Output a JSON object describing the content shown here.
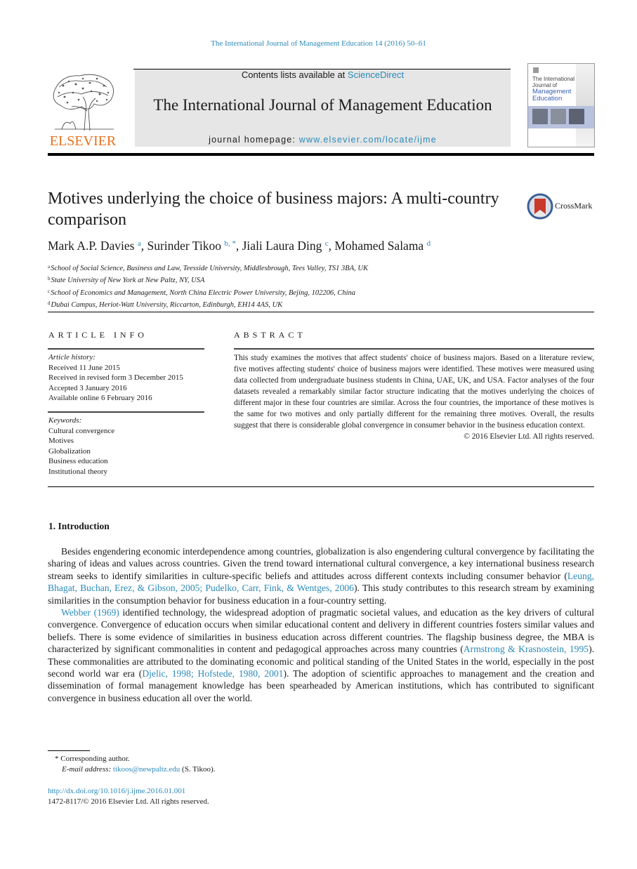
{
  "running_header": {
    "citation": "The International Journal of Management Education 14 (2016) 50–61"
  },
  "masthead": {
    "publisher_wordmark": "ELSEVIER",
    "contents_prefix": "Contents lists available at ",
    "contents_link": "ScienceDirect",
    "journal_title": "The International Journal of Management Education",
    "homepage_prefix": "journal homepage: ",
    "homepage_link": "www.elsevier.com/locate/ijme",
    "cover": {
      "line1": "The International",
      "line2": "Journal of",
      "line3": "Management",
      "line4": "Education"
    },
    "colors": {
      "link": "#2a89b9",
      "elsevier_orange": "#e9711c",
      "masthead_gray": "#e6e6e6"
    }
  },
  "article": {
    "title": "Motives underlying the choice of business majors: A multi-country comparison",
    "crossmark_label": "CrossMark",
    "authors": [
      {
        "name": "Mark A.P. Davies",
        "sup": "a"
      },
      {
        "name": "Surinder Tikoo",
        "sup": "b, *"
      },
      {
        "name": "Jiali Laura Ding",
        "sup": "c"
      },
      {
        "name": "Mohamed Salama",
        "sup": "d"
      }
    ],
    "affiliations": [
      {
        "key": "a",
        "text": "School of Social Science, Business and Law, Teesside University, Middlesbrough, Tees Valley, TS1 3BA, UK"
      },
      {
        "key": "b",
        "text": "State University of New York at New Paltz, NY, USA"
      },
      {
        "key": "c",
        "text": "School of Economics and Management, North China Electric Power University, Bejing, 102206, China"
      },
      {
        "key": "d",
        "text": "Dubai Campus, Heriot-Watt University, Riccarton, Edinburgh, EH14 4AS, UK"
      }
    ]
  },
  "article_info": {
    "heading": "ARTICLE INFO",
    "history_label": "Article history:",
    "history": [
      "Received 11 June 2015",
      "Received in revised form 3 December 2015",
      "Accepted 3 January 2016",
      "Available online 6 February 2016"
    ],
    "keywords_label": "Keywords:",
    "keywords": [
      "Cultural convergence",
      "Motives",
      "Globalization",
      "Business education",
      "Institutional theory"
    ]
  },
  "abstract": {
    "heading": "ABSTRACT",
    "text": "This study examines the motives that affect students' choice of business majors. Based on a literature review, five motives affecting students' choice of business majors were identified. These motives were measured using data collected from undergraduate business students in China, UAE, UK, and USA. Factor analyses of the four datasets revealed a remarkably similar factor structure indicating that the motives underlying the choices of different major in these four countries are similar. Across the four countries, the importance of these motives is the same for two motives and only partially different for the remaining three motives. Overall, the results suggest that there is considerable global convergence in consumer behavior in the business education context.",
    "copyright": "© 2016 Elsevier Ltd. All rights reserved."
  },
  "introduction": {
    "heading": "1.  Introduction",
    "p1": {
      "t1": "Besides engendering economic interdependence among countries, globalization is also engendering cultural convergence by facilitating the sharing of ideas and values across countries. Given the trend toward international cultural convergence, a key international business research stream seeks to identify similarities in culture-specific beliefs and attitudes across different contexts including consumer behavior (",
      "ref1": "Leung, Bhagat, Buchan, Erez, & Gibson, 2005; Pudelko, Carr, Fink, & Wentges, 2006",
      "t2": "). This study contributes to this research stream by examining similarities in the consumption behavior for business education in a four-country setting."
    },
    "p2": {
      "ref1": "Webber (1969)",
      "t1": " identified technology, the widespread adoption of pragmatic societal values, and education as the key drivers of cultural convergence. Convergence of education occurs when similar educational content and delivery in different countries fosters similar values and beliefs. There is some evidence of similarities in business education across different countries. The flagship business degree, the MBA is characterized by significant commonalities in content and pedagogical approaches across many countries (",
      "ref2": "Armstrong & Krasnostein, 1995",
      "t2": "). These commonalities are attributed to the dominating economic and political standing of the United States in the world, especially in the post second world war era (",
      "ref3": "Djelic, 1998; Hofstede, 1980, 2001",
      "t3": "). The adoption of scientific approaches to management and the creation and dissemination of formal management knowledge has been spearheaded by American institutions, which has contributed to significant convergence in business education all over the world."
    }
  },
  "footnotes": {
    "corresponding": "* Corresponding author.",
    "email_label": "E-mail address:",
    "email": "tikoos@newpaltz.edu",
    "email_suffix": " (S. Tikoo).",
    "doi": "http://dx.doi.org/10.1016/j.ijme.2016.01.001",
    "issn_copyright": "1472-8117/© 2016 Elsevier Ltd. All rights reserved."
  }
}
